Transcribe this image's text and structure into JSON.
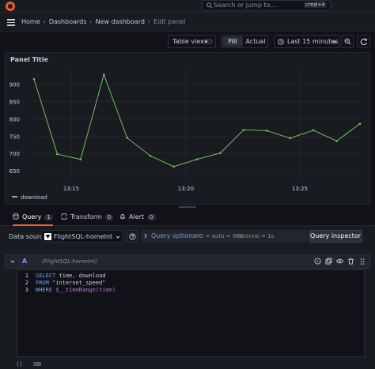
{
  "topbar": {
    "search_placeholder": "Search or jump to...",
    "search_shortcut": "cmd+k"
  },
  "breadcrumb": {
    "items": [
      "Home",
      "Dashboards",
      "New dashboard",
      "Edit panel"
    ]
  },
  "toolbar": {
    "table_view_label": "Table view",
    "fill_label": "Fill",
    "actual_label": "Actual",
    "time_range_label": "Last 15 minutes"
  },
  "panel": {
    "title": "Panel Title"
  },
  "chart_data": {
    "type": "line",
    "title": "Panel Title",
    "x_ticks": [
      "13:15",
      "13:20",
      "13:25"
    ],
    "y_ticks": [
      "650",
      "700",
      "750",
      "800",
      "850",
      "900"
    ],
    "ylim": [
      625,
      945
    ],
    "grid": true,
    "legend": "bottom-left",
    "series": [
      {
        "name": "download",
        "color": "#73bf69",
        "values": [
          915,
          698,
          683,
          928,
          745,
          693,
          662,
          683,
          701,
          768,
          766,
          744,
          767,
          736,
          786
        ]
      }
    ]
  },
  "tabs": [
    {
      "label": "Query",
      "count": "1",
      "icon": "database-icon"
    },
    {
      "label": "Transform",
      "count": "0",
      "icon": "transform-icon"
    },
    {
      "label": "Alert",
      "count": "0",
      "icon": "bell-icon"
    }
  ],
  "query": {
    "datasource_label": "Data source",
    "datasource_name": "FlightSQL-homeInt",
    "options_title": "Query options",
    "options_md": "MD = auto = 961",
    "options_interval": "Interval = 1s",
    "inspector_label": "Query inspector",
    "ref_id": "A",
    "ref_datasource": "(FlightSQL-homeInt)",
    "lines": [
      {
        "num": "1",
        "keyword": "SELECT",
        "rest": " time, download"
      },
      {
        "num": "2",
        "keyword": "FROM",
        "rest": " \"internet_speed\""
      },
      {
        "num": "3",
        "keyword": "WHERE",
        "rest": " $__timeRange(time)"
      }
    ]
  },
  "statusbar": {
    "left1": "{}",
    "left2": "⌨"
  }
}
